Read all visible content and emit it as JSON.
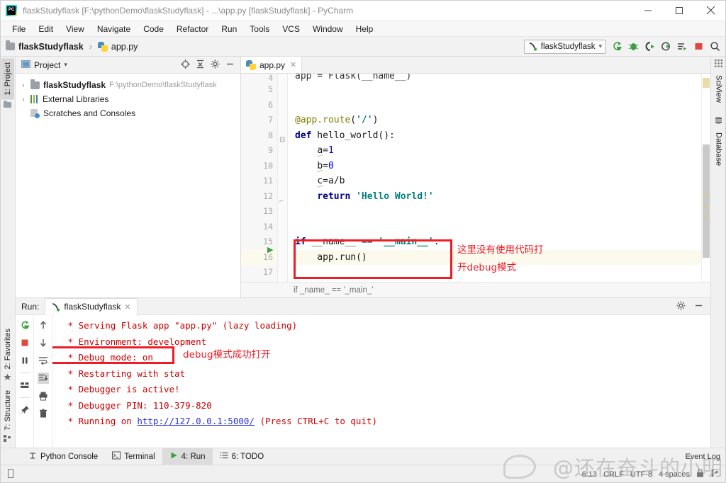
{
  "window": {
    "title": "flaskStudyflask [F:\\pythonDemo\\flaskStudyflask] - ...\\app.py [flaskStudyflask] - PyCharm",
    "logo": "pycharm-logo",
    "minimize": "–",
    "maximize": "▢",
    "close": "✕"
  },
  "menu": [
    "File",
    "Edit",
    "View",
    "Navigate",
    "Code",
    "Refactor",
    "Run",
    "Tools",
    "VCS",
    "Window",
    "Help"
  ],
  "breadcrumb": {
    "project": "flaskStudyflask",
    "separator": "›",
    "file": "app.py"
  },
  "toolbar": {
    "run_config": "flaskStudyflask",
    "icons": [
      "rerun-icon",
      "debug-icon",
      "coverage-icon",
      "profile-icon",
      "run-with-console-icon",
      "stop-icon",
      "search-everywhere-icon"
    ]
  },
  "left_tool_tabs": [
    {
      "label": "1: Project",
      "icon": "project-icon",
      "selected": true
    },
    {
      "label": "2: Favorites",
      "icon": "star-icon",
      "selected": false
    },
    {
      "label": "7: Structure",
      "icon": "structure-icon",
      "selected": false
    }
  ],
  "right_tool_tabs": [
    {
      "label": "SciView",
      "icon": "sciview-icon"
    },
    {
      "label": "Database",
      "icon": "database-icon"
    }
  ],
  "project_panel": {
    "title": "Project",
    "dropdown": "▾",
    "header_icons": [
      "locate-icon",
      "collapse-all-icon",
      "gear-icon",
      "hide-icon"
    ],
    "tree": [
      {
        "arrow": "›",
        "icon": "folder-icon",
        "label": "flaskStudyflask",
        "path": "F:\\pythonDemo\\flaskStudyflask",
        "bold": true
      },
      {
        "arrow": "›",
        "icon": "library-icon",
        "label": "External Libraries",
        "path": "",
        "bold": false
      },
      {
        "arrow": "",
        "icon": "scratches-icon",
        "label": "Scratches and Consoles",
        "path": "",
        "bold": false
      }
    ]
  },
  "editor": {
    "tab": {
      "label": "app.py",
      "icon": "python-file-icon",
      "close": "✕"
    },
    "lines": [
      {
        "no": "4",
        "text": "app = Flask(__name__)",
        "clipped": true
      },
      {
        "no": "5",
        "text": ""
      },
      {
        "no": "6",
        "text": ""
      },
      {
        "no": "7",
        "text": "@app.route('/')"
      },
      {
        "no": "8",
        "text": "def hello_world():"
      },
      {
        "no": "9",
        "text": "    a=1"
      },
      {
        "no": "10",
        "text": "    b=0"
      },
      {
        "no": "11",
        "text": "    c=a/b"
      },
      {
        "no": "12",
        "text": "    return 'Hello World!'"
      },
      {
        "no": "13",
        "text": ""
      },
      {
        "no": "14",
        "text": ""
      },
      {
        "no": "15",
        "text": "if __name__ == '__main__':"
      },
      {
        "no": "16",
        "text": "    app.run()"
      },
      {
        "no": "17",
        "text": ""
      }
    ],
    "annotation": {
      "line1": "这里没有使用代码打",
      "line2": "开debug模式",
      "color": "#ee1c25"
    },
    "breadcrumb_status": "if _name_ == '_main_'",
    "run_gutter_marker": "▶"
  },
  "run_panel": {
    "label": "Run:",
    "tab": "flaskStudyflask",
    "tab_close": "✕",
    "header_icons": [
      "gear-icon",
      "hide-icon"
    ],
    "left_tools": [
      "rerun-icon",
      "stop-icon",
      "pause-icon",
      "divider",
      "layout-icon",
      "divider2",
      "pin-icon"
    ],
    "right_tools": [
      "up-icon",
      "down-icon",
      "soft-wrap-icon",
      "scroll-to-end-icon",
      "print-icon",
      "clear-all-icon"
    ],
    "console": [
      {
        "text": " * Serving Flask app \"app.py\" (lazy loading)"
      },
      {
        "text": " * Environment: development"
      },
      {
        "text": " * Debug mode: on",
        "boxed": true
      },
      {
        "text": " * Restarting with stat"
      },
      {
        "text": " * Debugger is active!"
      },
      {
        "text": " * Debugger PIN: 110-379-820"
      },
      {
        "text": " * Running on ",
        "link": "http://127.0.0.1:5000/",
        "suffix": " (Press CTRL+C to quit)"
      }
    ],
    "annotation": "debug模式成功打开"
  },
  "statusbar": {
    "items": [
      {
        "label": "Python Console",
        "icon": "python-console-icon",
        "selected": false
      },
      {
        "label": "Terminal",
        "icon": "terminal-icon",
        "selected": false
      },
      {
        "label": "4: Run",
        "icon": "run-icon",
        "selected": true
      },
      {
        "label": "6: TODO",
        "icon": "todo-icon",
        "selected": false
      }
    ],
    "event_log": "Event Log",
    "right": [
      "6:13",
      "CRLF",
      "UTF-8",
      "4 spaces",
      "lock-icon",
      "branch-icon"
    ]
  },
  "watermark": {
    "text": "@还在奋斗的小明",
    "logo": "weibo-logo"
  },
  "colors": {
    "accent_red": "#ee1c25",
    "console_red": "#cc0000",
    "link_blue": "#2b31d6",
    "keyword_blue": "#000080",
    "string_teal": "#008080",
    "decorator_olive": "#808000",
    "run_green": "#3c9f40"
  }
}
